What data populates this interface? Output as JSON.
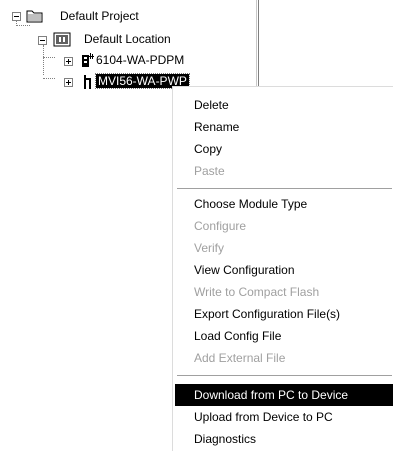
{
  "tree": {
    "nodes": [
      {
        "label": "Default Project",
        "icon": "folder-icon"
      },
      {
        "label": "Default Location",
        "icon": "location-icon"
      },
      {
        "label": "6104-WA-PDPM",
        "icon": "device-icon"
      },
      {
        "label": "MVI56-WA-PWP",
        "icon": "module-icon",
        "selected": true
      }
    ]
  },
  "context_menu": {
    "groups": [
      [
        {
          "label": "Delete",
          "disabled": false
        },
        {
          "label": "Rename",
          "disabled": false
        },
        {
          "label": "Copy",
          "disabled": false
        },
        {
          "label": "Paste",
          "disabled": true
        }
      ],
      [
        {
          "label": "Choose Module Type",
          "disabled": false
        },
        {
          "label": "Configure",
          "disabled": true
        },
        {
          "label": "Verify",
          "disabled": true
        },
        {
          "label": "View Configuration",
          "disabled": false
        },
        {
          "label": "Write to Compact Flash",
          "disabled": true
        },
        {
          "label": "Export Configuration File(s)",
          "disabled": false
        },
        {
          "label": "Load Config File",
          "disabled": false
        },
        {
          "label": "Add External File",
          "disabled": true
        }
      ],
      [
        {
          "label": "Download from PC to Device",
          "disabled": false,
          "highlighted": true
        },
        {
          "label": "Upload from Device to PC",
          "disabled": false
        },
        {
          "label": "Diagnostics",
          "disabled": false
        }
      ]
    ]
  }
}
